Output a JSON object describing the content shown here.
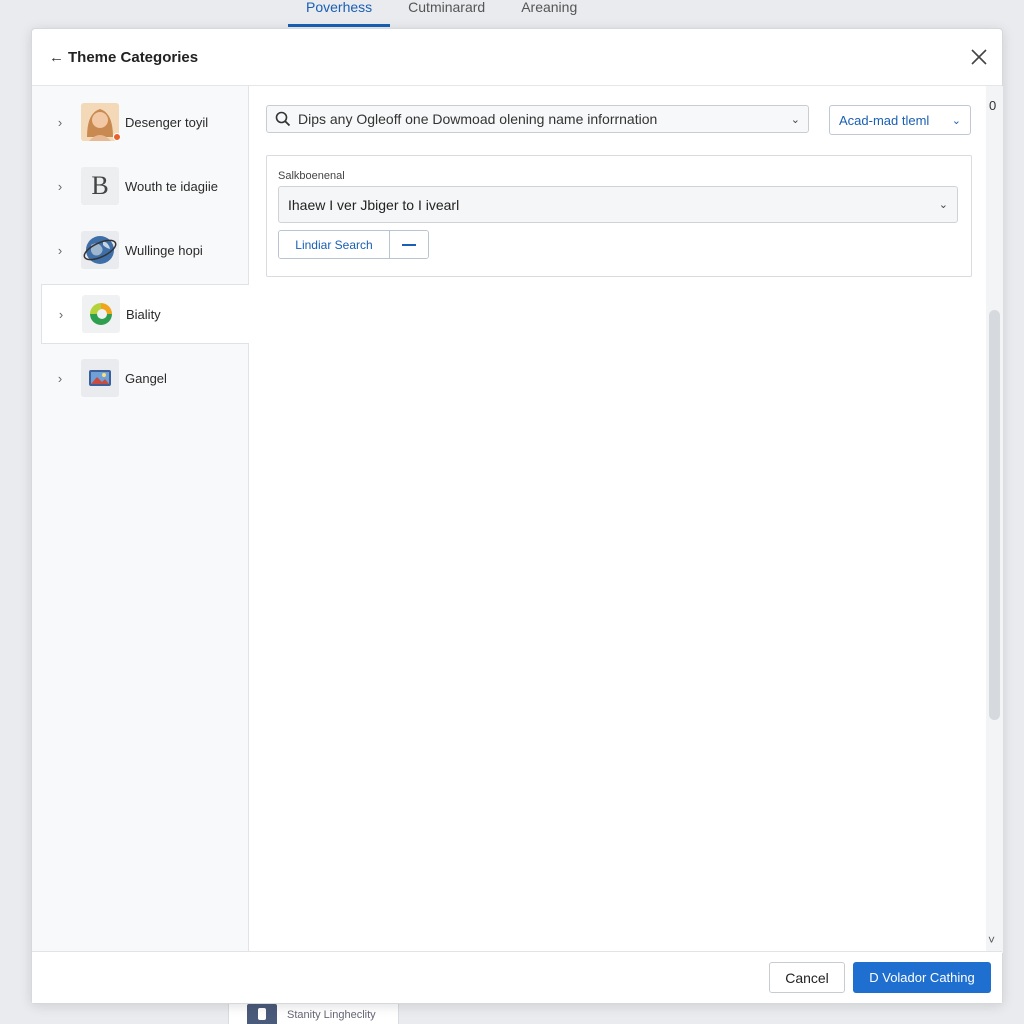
{
  "top_tabs": [
    "Poverhess",
    "Cutminarard",
    "Areaning"
  ],
  "dialog": {
    "back_arrow": "←",
    "title": "Theme Categories",
    "close_icon": "close-icon"
  },
  "sidebar": {
    "items": [
      {
        "label": "Desenger toyil",
        "icon": "user-avatar-icon"
      },
      {
        "label": "Wouth te idagiie",
        "icon": "letter-b-icon",
        "glyph": "B"
      },
      {
        "label": "Wullinge hopi",
        "icon": "globe-icon"
      },
      {
        "label": "Biality",
        "icon": "color-swirl-icon"
      },
      {
        "label": "Gangel",
        "icon": "landscape-image-icon"
      }
    ],
    "active_index": 3
  },
  "main": {
    "search": {
      "value": "Dips any Ogleoff one Dowmoad olening name inforrnation",
      "icon": "search-icon"
    },
    "add_theme_label": "Acad-mad tleml",
    "panel": {
      "label": "Salkboenenal",
      "select_value": "Ihaew I ver Jbiger to I ivearl",
      "linked_search_label": "Lindiar Search",
      "minus_icon": "minus-icon"
    }
  },
  "scrollbar": {
    "top_marker": "0",
    "down_arrow": "˅"
  },
  "footer": {
    "cancel_label": "Cancel",
    "primary_label": "D Volador Cathing"
  },
  "ghost_tab": {
    "label": "Stanity Lingheclity",
    "icon": "upload-icon"
  },
  "colors": {
    "accent": "#1f6fd1",
    "link": "#1a5fb4"
  }
}
